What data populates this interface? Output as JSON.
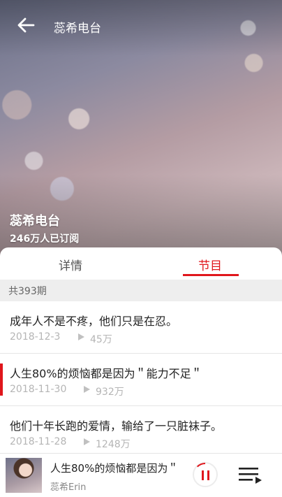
{
  "header": {
    "title": "蕊希电台"
  },
  "hero": {
    "radio_name": "蕊希电台",
    "subscribers": "246万人已订阅"
  },
  "tabs": [
    {
      "label": "详情",
      "active": false
    },
    {
      "label": "节目",
      "active": true
    }
  ],
  "episode_count": "共393期",
  "episodes": [
    {
      "title": "成年人不是不疼，他们只是在忍。",
      "date": "2018-12-3",
      "plays": "45万",
      "playing": false
    },
    {
      "title": "人生80%的烦恼都是因为＂能力不足＂",
      "date": "2018-11-30",
      "plays": "932万",
      "playing": true
    },
    {
      "title": "他们十年长跑的爱情，输给了一只脏袜子。",
      "date": "2018-11-28",
      "plays": "1248万",
      "playing": false
    }
  ],
  "player": {
    "title": "人生80%的烦恼都是因为＂",
    "artist": "蕊希Erin",
    "state": "playing"
  },
  "colors": {
    "accent": "#e0161c",
    "divider": "#eeeeee"
  },
  "icons": [
    "back-arrow-icon",
    "play-icon",
    "pause-icon",
    "playlist-icon"
  ]
}
